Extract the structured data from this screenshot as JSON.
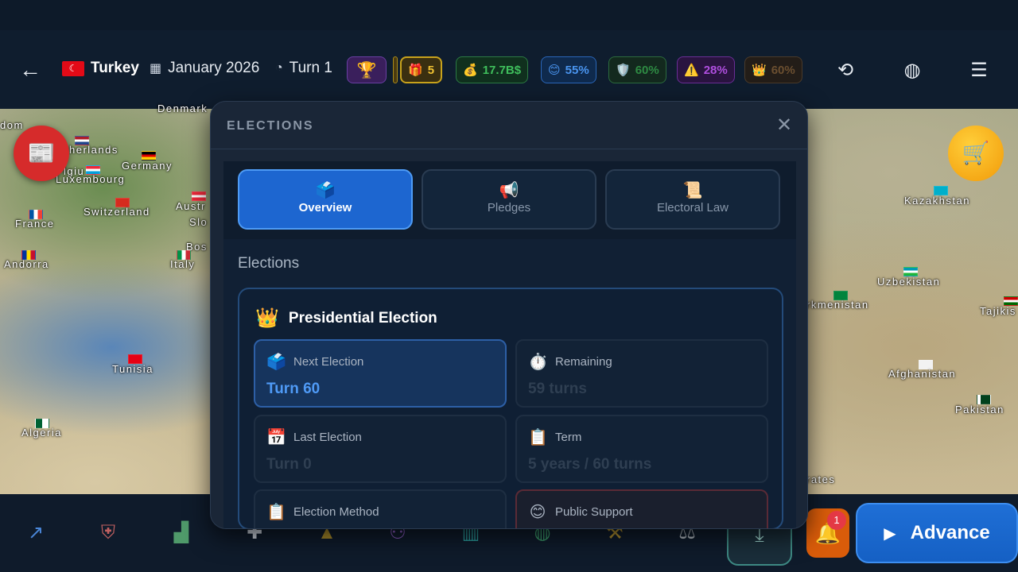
{
  "header": {
    "country": "Turkey",
    "country_flag_glyph": "☾",
    "date": "January 2026",
    "turn": "Turn 1"
  },
  "stats": [
    {
      "name": "gift",
      "icon": "🎁",
      "value": "5",
      "color": "#f1c232"
    },
    {
      "name": "money",
      "icon": "💰",
      "value": "17.7B$",
      "color": "#36a852"
    },
    {
      "name": "happiness",
      "icon": "😊",
      "value": "55%",
      "color": "#3d8ef0"
    },
    {
      "name": "security",
      "icon": "🛡️",
      "value": "60%",
      "color": "#2e8b43"
    },
    {
      "name": "risk",
      "icon": "⚠️",
      "value": "28%",
      "color": "#9b3fc8"
    },
    {
      "name": "authority",
      "icon": "👑",
      "value": "60%",
      "color": "#6b4a2a"
    }
  ],
  "map_labels": [
    {
      "text": "dom"
    },
    {
      "text": "herlands"
    },
    {
      "text": "Germany"
    },
    {
      "text": "lgiu"
    },
    {
      "text": "Luxembourg"
    },
    {
      "text": "France"
    },
    {
      "text": "Switzerland"
    },
    {
      "text": "Austr"
    },
    {
      "text": "Slo"
    },
    {
      "text": "Bos"
    },
    {
      "text": "Andorra"
    },
    {
      "text": "Italy"
    },
    {
      "text": "Tunisia"
    },
    {
      "text": "Algeria"
    },
    {
      "text": "Kazakhstan"
    },
    {
      "text": "Uzbekistan"
    },
    {
      "text": "rkmenistan"
    },
    {
      "text": "Tajikis"
    },
    {
      "text": "Afghanistan"
    },
    {
      "text": "Pakistan"
    },
    {
      "text": "rates"
    },
    {
      "text": "Denmark"
    }
  ],
  "modal": {
    "title": "ELECTIONS",
    "close_glyph": "✕",
    "tabs": [
      {
        "label": "Overview",
        "icon": "🗳️"
      },
      {
        "label": "Pledges",
        "icon": "📢"
      },
      {
        "label": "Electoral Law",
        "icon": "📜"
      }
    ],
    "section_title": "Elections",
    "card": {
      "icon": "👑",
      "title": "Presidential Election",
      "cells": [
        {
          "icon": "🗳️",
          "label": "Next Election",
          "value": "Turn 60"
        },
        {
          "icon": "⏱️",
          "label": "Remaining",
          "value": "59 turns"
        },
        {
          "icon": "📅",
          "label": "Last Election",
          "value": "Turn 0"
        },
        {
          "icon": "📋",
          "label": "Term",
          "value": "5 years / 60 turns"
        },
        {
          "icon": "📋",
          "label": "Election Method",
          "value": ""
        },
        {
          "icon": "😊",
          "label": "Public Support",
          "value": ""
        }
      ]
    }
  },
  "bottom": {
    "notification_count": "1",
    "advance_label": "Advance"
  }
}
